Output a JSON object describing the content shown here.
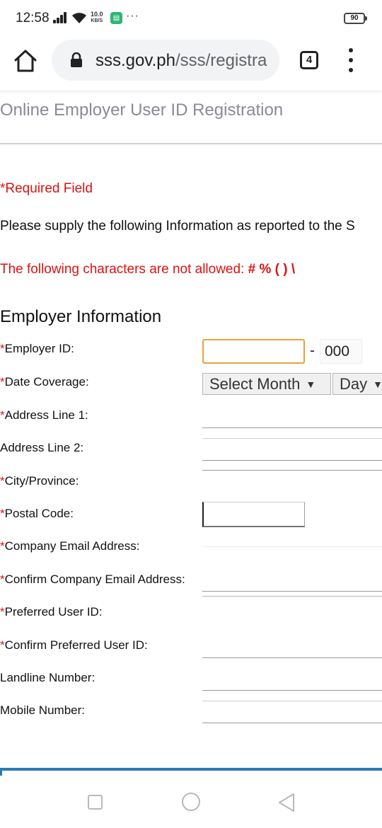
{
  "status_bar": {
    "time": "12:58",
    "net_speed_value": "10.0",
    "net_speed_unit": "KB/S",
    "more": "···",
    "battery": "90"
  },
  "browser": {
    "url_domain": "sss.gov.ph",
    "url_path": "/sss/registra",
    "tab_count": "4"
  },
  "page": {
    "title": "Online Employer User ID Registration",
    "required_note": "*Required Field",
    "instruction": "Please supply the following Information as reported to the S",
    "chars_note": "The following characters are not allowed:",
    "disallowed_chars": "# % ( ) \\",
    "section_heading": "Employer Information"
  },
  "form": {
    "required_mark": "*",
    "branch_code": "000",
    "dash": "-",
    "month_select": "Select Month",
    "day_select": "Day",
    "labels": {
      "employer_id": "Employer ID:",
      "date_coverage": "Date Coverage:",
      "address1": "Address Line 1:",
      "address2": "Address Line 2:",
      "city": "City/Province:",
      "postal": "Postal Code:",
      "company_email": "Company Email Address:",
      "confirm_email": "Confirm Company Email Address:",
      "preferred_user": "Preferred User ID:",
      "confirm_user": "Confirm Preferred User ID:",
      "landline": "Landline Number:",
      "mobile": "Mobile Number:"
    }
  },
  "colors": {
    "required_red": "#dd1111",
    "focus_orange": "#e8a33b",
    "title_gray": "#8a8a96",
    "footer_blue": "#2a7ab5"
  }
}
